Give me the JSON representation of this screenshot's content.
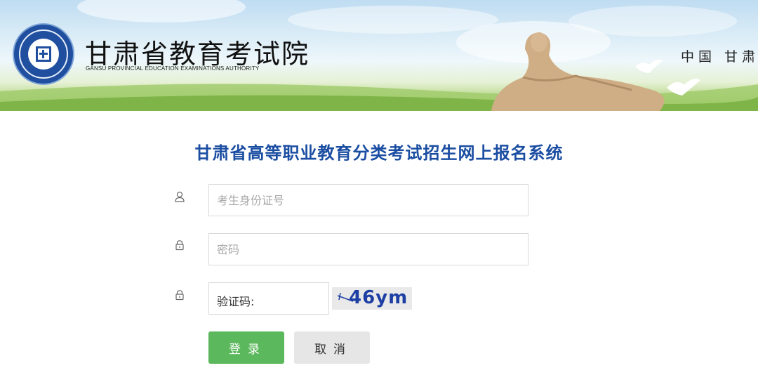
{
  "header": {
    "org_name": "甘肃省教育考试院",
    "org_name_en": "GANSU PROVINCIAL EDUCATION EXAMINATIONS AUTHORITY",
    "region": "中国 甘肃"
  },
  "form": {
    "title": "甘肃省高等职业教育分类考试招生网上报名系统",
    "id_field": {
      "placeholder": "考生身份证号",
      "value": "",
      "icon": "user-icon"
    },
    "password_field": {
      "placeholder": "密码",
      "value": "",
      "icon": "lock-icon"
    },
    "captcha": {
      "label": "验证码:",
      "image_text": "46ym",
      "icon": "lock-icon"
    },
    "login_label": "登录",
    "cancel_label": "取消"
  },
  "colors": {
    "title": "#1b4ea2",
    "login_button": "#5cb85c",
    "cancel_button": "#e6e6e6"
  }
}
